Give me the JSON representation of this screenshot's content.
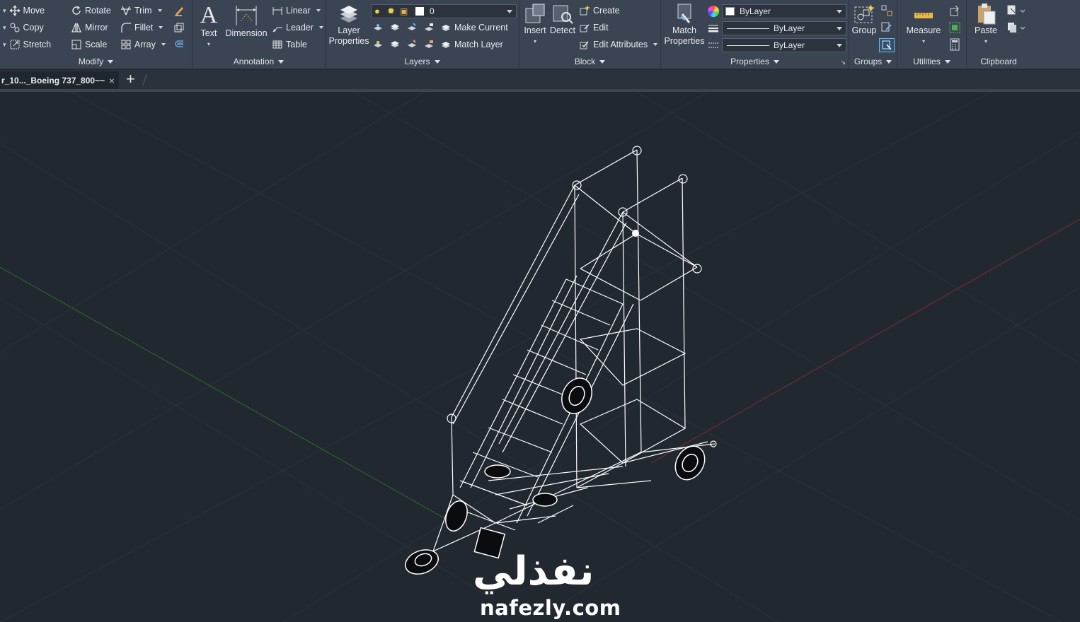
{
  "ribbon": {
    "modify": {
      "title": "Modify",
      "move": "Move",
      "rotate": "Rotate",
      "trim": "Trim",
      "copy": "Copy",
      "mirror": "Mirror",
      "fillet": "Fillet",
      "stretch": "Stretch",
      "scale": "Scale",
      "array": "Array"
    },
    "annotation": {
      "title": "Annotation",
      "text": "Text",
      "dimension": "Dimension",
      "linear": "Linear",
      "leader": "Leader",
      "table": "Table"
    },
    "layers": {
      "title": "Layers",
      "layer_properties_1": "Layer",
      "layer_properties_2": "Properties",
      "current_layer": "0",
      "make_current": "Make Current",
      "match_layer": "Match Layer"
    },
    "block": {
      "title": "Block",
      "insert": "Insert",
      "detect": "Detect",
      "create": "Create",
      "edit": "Edit",
      "edit_attributes": "Edit Attributes"
    },
    "properties": {
      "title": "Properties",
      "match_1": "Match",
      "match_2": "Properties",
      "color": "ByLayer",
      "linetype": "ByLayer",
      "lineweight": "ByLayer"
    },
    "groups": {
      "title": "Groups",
      "group": "Group"
    },
    "utilities": {
      "title": "Utilities",
      "measure": "Measure"
    },
    "clipboard": {
      "title": "Clipboard",
      "paste": "Paste"
    }
  },
  "tabs": {
    "document": "r_10..._Boeing 737_800~~",
    "close": "×",
    "new": "+"
  },
  "watermark": {
    "arabic": "نفذلي",
    "latin": "nafezly.com"
  },
  "colors": {
    "ribbon_bg": "#3b4453",
    "viewport_bg": "#212830",
    "x_axis": "#8a2a2a",
    "y_axis": "#2c6b2c",
    "model": "#ffffff"
  }
}
